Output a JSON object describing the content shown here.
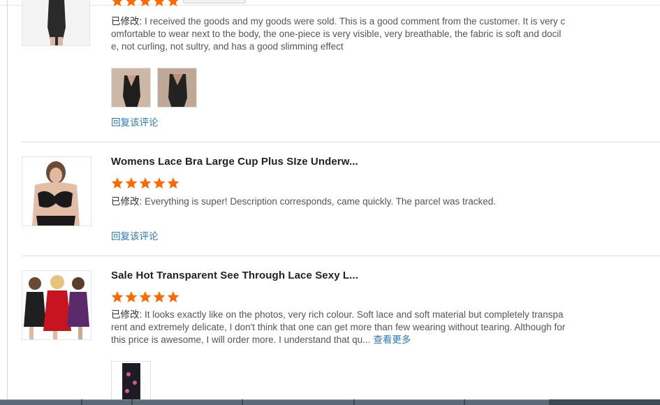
{
  "reviews": [
    {
      "title": "",
      "rating": 5,
      "comment_prefix": "已修改: ",
      "comment": "I received the goods and my goods were sold. This is a good comment from the customer. It is very comfortable to wear next to the body, the one-piece is very visible, very breathable, the fabric is soft and docile, not curling, not sultry, and has a good slimming effect",
      "photos": [
        "photo-1",
        "photo-2"
      ],
      "reply_label": "回复该评论"
    },
    {
      "title": "Womens Lace Bra Large Cup Plus SIze Underw...",
      "rating": 5,
      "comment_prefix": "已修改: ",
      "comment": "Everything is super! Description corresponds, came quickly. The parcel was tracked.",
      "reply_label": "回复该评论"
    },
    {
      "title": "Sale Hot Transparent See Through Lace Sexy L...",
      "rating": 5,
      "comment_prefix": "已修改: ",
      "comment": "It looks exactly like on the photos, very rich  colour. Soft lace and soft material but completely transparent and extremely delicate, I don't think that one can get more than few wearing without tearing. Although for this price is awesome, I will order more. I understand that qu...",
      "more_label": "查看更多",
      "photos": [
        "photo-1"
      ]
    }
  ],
  "colors": {
    "star": "#ff6a00",
    "link": "#2a7ab8",
    "divider": "#dcdcdc"
  }
}
